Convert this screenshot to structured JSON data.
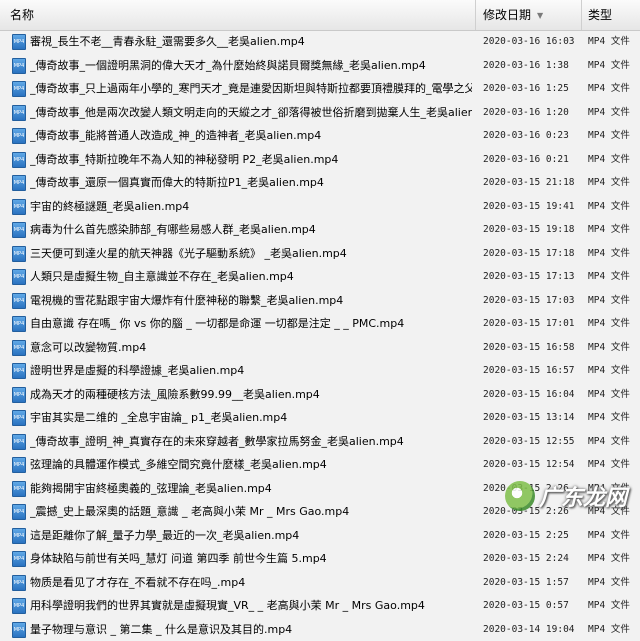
{
  "header": {
    "name_label": "名称",
    "date_label": "修改日期",
    "type_label": "类型"
  },
  "files": [
    {
      "name": "審視_長生不老__青春永駐_還需要多久__老吳alien.mp4",
      "date": "2020-03-16 16:03",
      "type": "MP4 文件"
    },
    {
      "name": "_傳奇故事_一個證明黑洞的偉大天才_為什麼始終與諾貝爾獎無緣_老吳alien.mp4",
      "date": "2020-03-16 1:38",
      "type": "MP4 文件"
    },
    {
      "name": "_傳奇故事_只上過兩年小學的_寒門天才_竟是連愛因斯坦與特斯拉都要頂禮膜拜的_電學之父...",
      "date": "2020-03-16 1:25",
      "type": "MP4 文件"
    },
    {
      "name": "_傳奇故事_他是兩次改變人類文明走向的天縱之才_卻落得被世俗折磨到拋棄人生_老吳alien.mp4",
      "date": "2020-03-16 1:20",
      "type": "MP4 文件"
    },
    {
      "name": "_傳奇故事_能將普通人改造成_神_的造神者_老吳alien.mp4",
      "date": "2020-03-16 0:23",
      "type": "MP4 文件"
    },
    {
      "name": "_傳奇故事_特斯拉晚年不為人知的神秘發明 P2_老吳alien.mp4",
      "date": "2020-03-16 0:21",
      "type": "MP4 文件"
    },
    {
      "name": "_傳奇故事_還原一個真實而偉大的特斯拉P1_老吳alien.mp4",
      "date": "2020-03-15 21:18",
      "type": "MP4 文件"
    },
    {
      "name": "宇宙的終極謎題_老吳alien.mp4",
      "date": "2020-03-15 19:41",
      "type": "MP4 文件"
    },
    {
      "name": "病毒为什么首先感染肺部_有哪些易感人群_老吳alien.mp4",
      "date": "2020-03-15 19:18",
      "type": "MP4 文件"
    },
    {
      "name": "三天便可到達火星的航天神器《光子驅動系統》 _老吳alien.mp4",
      "date": "2020-03-15 17:18",
      "type": "MP4 文件"
    },
    {
      "name": "人類只是虛擬生物_自主意識並不存在_老吳alien.mp4",
      "date": "2020-03-15 17:13",
      "type": "MP4 文件"
    },
    {
      "name": "電視機的雪花點跟宇宙大爆炸有什麼神秘的聯繫_老吳alien.mp4",
      "date": "2020-03-15 17:03",
      "type": "MP4 文件"
    },
    {
      "name": "自由意識 存在嗎_ 你 vs 你的腦 _ 一切都是命運 一切都是注定 _ _ PMC.mp4",
      "date": "2020-03-15 17:01",
      "type": "MP4 文件"
    },
    {
      "name": "意念可以改變物質.mp4",
      "date": "2020-03-15 16:58",
      "type": "MP4 文件"
    },
    {
      "name": "證明世界是虛擬的科學證據_老吳alien.mp4",
      "date": "2020-03-15 16:57",
      "type": "MP4 文件"
    },
    {
      "name": "成為天才的兩種硬核方法_風險系數99.99__老吳alien.mp4",
      "date": "2020-03-15 16:04",
      "type": "MP4 文件"
    },
    {
      "name": "宇宙其实是二维的 _全息宇宙論_ p1_老吳alien.mp4",
      "date": "2020-03-15 13:14",
      "type": "MP4 文件"
    },
    {
      "name": "_傳奇故事_證明_神_真實存在的未來穿越者_數學家拉馬努金_老吳alien.mp4",
      "date": "2020-03-15 12:55",
      "type": "MP4 文件"
    },
    {
      "name": "弦理論的具體運作模式_多維空間究竟什麼樣_老吳alien.mp4",
      "date": "2020-03-15 12:54",
      "type": "MP4 文件"
    },
    {
      "name": "能夠揭開宇宙終極奧義的_弦理論_老吳alien.mp4",
      "date": "2020-03-15 2:26",
      "type": "MP4 文件"
    },
    {
      "name": "_震撼_史上最深奧的話題_意識 _ 老高與小茉 Mr _ Mrs Gao.mp4",
      "date": "2020-03-15 2:26",
      "type": "MP4 文件"
    },
    {
      "name": "這是距離你了解_量子力學_最近的一次_老吳alien.mp4",
      "date": "2020-03-15 2:25",
      "type": "MP4 文件"
    },
    {
      "name": "身体缺陷与前世有关吗_慧灯 问道 第四季 前世今生篇 5.mp4",
      "date": "2020-03-15 2:24",
      "type": "MP4 文件"
    },
    {
      "name": "物质是看见了才存在_不看就不存在吗_.mp4",
      "date": "2020-03-15 1:57",
      "type": "MP4 文件"
    },
    {
      "name": "用科學證明我們的世界其實就是虛擬現實_VR_ _ 老高與小茉 Mr _ Mrs Gao.mp4",
      "date": "2020-03-15 0:57",
      "type": "MP4 文件"
    },
    {
      "name": "量子物理与意识 _ 第二集 _ 什么是意识及其目的.mp4",
      "date": "2020-03-14 19:04",
      "type": "MP4 文件"
    }
  ],
  "watermark": {
    "text": "广东龙网"
  }
}
